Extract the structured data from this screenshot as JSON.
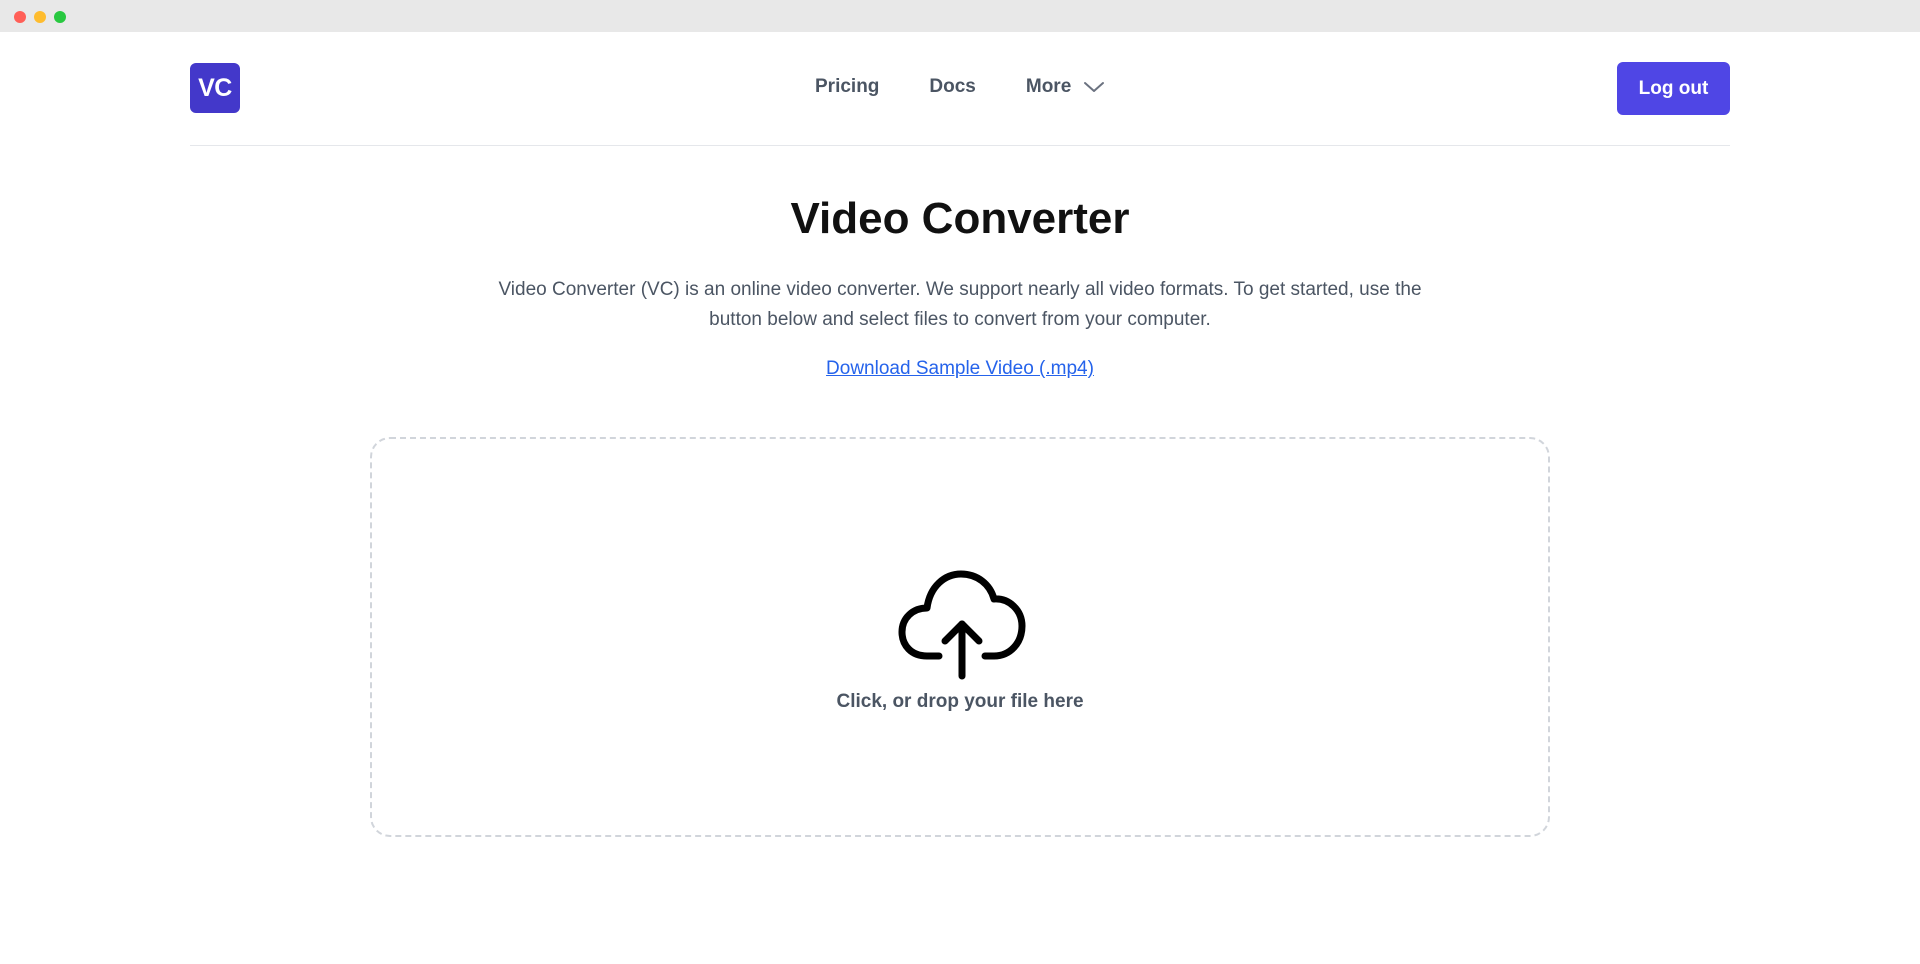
{
  "window": {
    "controls": [
      "close",
      "minimize",
      "maximize"
    ]
  },
  "header": {
    "logo_text": "VC",
    "nav": {
      "pricing": "Pricing",
      "docs": "Docs",
      "more": "More"
    },
    "logout_label": "Log out"
  },
  "main": {
    "title": "Video Converter",
    "description": "Video Converter (VC) is an online video converter. We support nearly all video formats. To get started, use the button below and select files to convert from your computer.",
    "sample_link": "Download Sample Video (.mp4)",
    "dropzone": {
      "icon": "cloud-upload-icon",
      "label": "Click, or drop your file here"
    }
  },
  "colors": {
    "brand": "#4338ca",
    "button": "#4f46e5",
    "link": "#2563eb",
    "muted_text": "#4b5563"
  }
}
